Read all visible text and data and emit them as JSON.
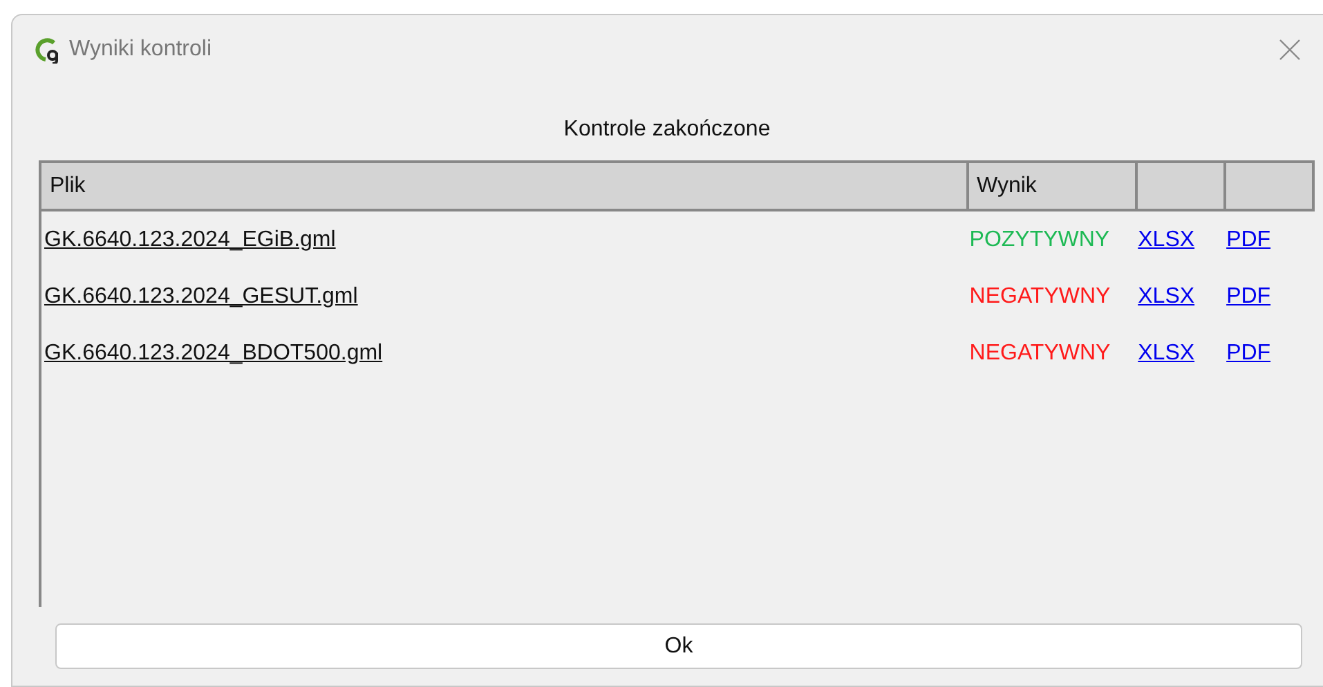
{
  "window": {
    "title": "Wyniki kontroli"
  },
  "heading": "Kontrole zakończone",
  "table": {
    "columns": [
      "Plik",
      "Wynik"
    ],
    "rows": [
      {
        "file": "GK.6640.123.2024_EGiB.gml",
        "result": "POZYTYWNY",
        "color": "#1db954",
        "xlsx": "XLSX",
        "pdf": "PDF"
      },
      {
        "file": "GK.6640.123.2024_GESUT.gml",
        "result": "NEGATYWNY",
        "color": "#ff1a1a",
        "xlsx": "XLSX",
        "pdf": "PDF"
      },
      {
        "file": "GK.6640.123.2024_BDOT500.gml",
        "result": "NEGATYWNY",
        "color": "#ff1a1a",
        "xlsx": "XLSX",
        "pdf": "PDF"
      }
    ]
  },
  "ok_button": "Ok"
}
